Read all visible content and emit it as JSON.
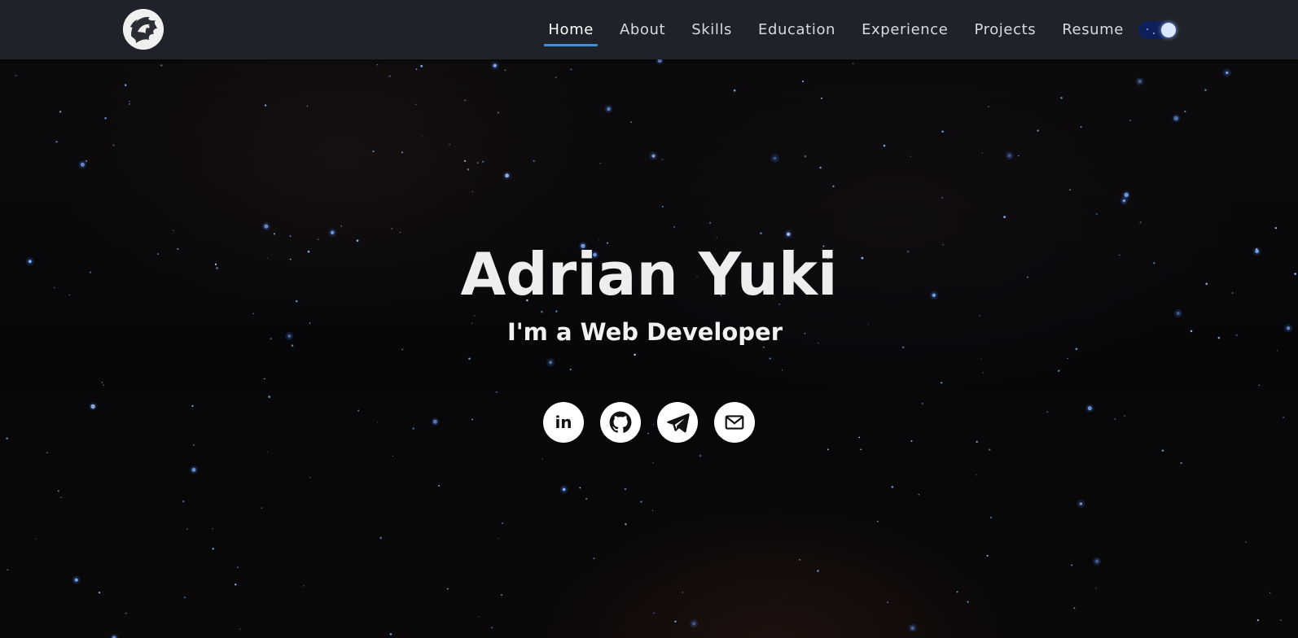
{
  "nav": {
    "logo_icon": "dragon-logo-icon",
    "items": [
      {
        "label": "Home",
        "active": true
      },
      {
        "label": "About",
        "active": false
      },
      {
        "label": "Skills",
        "active": false
      },
      {
        "label": "Education",
        "active": false
      },
      {
        "label": "Experience",
        "active": false
      },
      {
        "label": "Projects",
        "active": false
      },
      {
        "label": "Resume",
        "active": false
      }
    ],
    "theme_toggle": {
      "icon": "moon-toggle-icon",
      "state": "dark"
    }
  },
  "hero": {
    "name": "Adrian Yuki",
    "subtitle": "I'm a Web Developer",
    "socials": [
      {
        "name": "linkedin",
        "icon": "linkedin-icon",
        "glyph": "in"
      },
      {
        "name": "github",
        "icon": "github-icon"
      },
      {
        "name": "telegram",
        "icon": "telegram-icon"
      },
      {
        "name": "email",
        "icon": "mail-icon"
      }
    ]
  },
  "colors": {
    "navbar_bg": "#1f2329",
    "active_underline": "#3e8ee0",
    "hero_bg": "#07070a",
    "star": "#8cb8ff"
  }
}
